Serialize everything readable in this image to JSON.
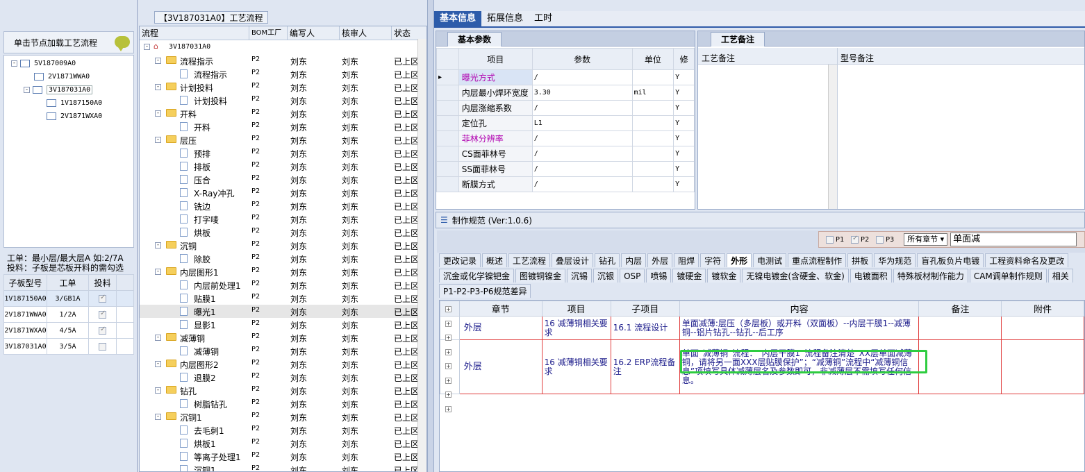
{
  "left": {
    "load_label": "单击节点加载工艺流程",
    "tree": [
      {
        "label": "5V187009A0",
        "level": 0,
        "expand": "-"
      },
      {
        "label": "2V1871WWA0",
        "level": 1,
        "expand": ""
      },
      {
        "label": "3V187031A0",
        "level": 1,
        "expand": "-",
        "selected": true
      },
      {
        "label": "1V187150A0",
        "level": 2,
        "expand": ""
      },
      {
        "label": "2V1871WXA0",
        "level": 2,
        "expand": ""
      }
    ],
    "info_line1": "工单：最小层/最大层A 如:2/7A",
    "info_line2": "投料：子板是芯板开料的需勾选",
    "sub_headers": [
      "子板型号",
      "工单",
      "投料"
    ],
    "sub_rows": [
      {
        "model": "1V187150A0",
        "order": "3/GB1A",
        "feed": true
      },
      {
        "model": "2V1871WWA0",
        "order": "1/2A",
        "feed": true
      },
      {
        "model": "2V1871WXA0",
        "order": "4/5A",
        "feed": true
      },
      {
        "model": "3V187031A0",
        "order": "3/5A",
        "feed": false
      }
    ]
  },
  "middle": {
    "title": "【3V187031A0】工艺流程",
    "headers": [
      "流程",
      "BOM工厂",
      "编写人",
      "核审人",
      "状态"
    ],
    "root": "3V187031A0",
    "rows": [
      {
        "label": "流程指示",
        "type": "folder"
      },
      {
        "label": "流程指示",
        "type": "doc"
      },
      {
        "label": "计划投料",
        "type": "folder"
      },
      {
        "label": "计划投料",
        "type": "doc"
      },
      {
        "label": "开料",
        "type": "folder"
      },
      {
        "label": "开料",
        "type": "doc"
      },
      {
        "label": "层压",
        "type": "folder"
      },
      {
        "label": "预排",
        "type": "doc"
      },
      {
        "label": "排板",
        "type": "doc"
      },
      {
        "label": "压合",
        "type": "doc"
      },
      {
        "label": "X-Ray冲孔",
        "type": "doc"
      },
      {
        "label": "铣边",
        "type": "doc"
      },
      {
        "label": "打字唛",
        "type": "doc"
      },
      {
        "label": "烘板",
        "type": "doc"
      },
      {
        "label": "沉铜",
        "type": "folder"
      },
      {
        "label": "除胶",
        "type": "doc"
      },
      {
        "label": "内层图形1",
        "type": "folder"
      },
      {
        "label": "内层前处理1",
        "type": "doc"
      },
      {
        "label": "贴膜1",
        "type": "doc"
      },
      {
        "label": "曝光1",
        "type": "doc",
        "selected": true
      },
      {
        "label": "显影1",
        "type": "doc"
      },
      {
        "label": "减薄铜",
        "type": "folder"
      },
      {
        "label": "减薄铜",
        "type": "doc"
      },
      {
        "label": "内层图形2",
        "type": "folder"
      },
      {
        "label": "退膜2",
        "type": "doc"
      },
      {
        "label": "钻孔",
        "type": "folder"
      },
      {
        "label": "树脂钻孔",
        "type": "doc"
      },
      {
        "label": "沉铜1",
        "type": "folder"
      },
      {
        "label": "去毛刺1",
        "type": "doc"
      },
      {
        "label": "烘板1",
        "type": "doc"
      },
      {
        "label": "等离子处理1",
        "type": "doc"
      },
      {
        "label": "沉铜1",
        "type": "doc"
      }
    ],
    "bom": "P2",
    "writer": "刘东",
    "reviewer": "刘东",
    "status": "已上区"
  },
  "top_tabs": [
    "基本信息",
    "拓展信息",
    "工时"
  ],
  "basic": {
    "tab": "基本参数",
    "headers": [
      "项目",
      "参数",
      "单位",
      "修"
    ],
    "rows": [
      {
        "item": "曝光方式",
        "param": "/",
        "unit": "",
        "mod": "Y",
        "mag": true,
        "current": true
      },
      {
        "item": "内层最小焊环宽度",
        "param": "3.30",
        "unit": "mil",
        "mod": "Y"
      },
      {
        "item": "内层涨缩系数",
        "param": "/",
        "unit": "",
        "mod": "Y"
      },
      {
        "item": "定位孔",
        "param": "L1",
        "unit": "",
        "mod": "Y"
      },
      {
        "item": "菲林分辨率",
        "param": "/",
        "unit": "",
        "mod": "Y",
        "mag": true
      },
      {
        "item": "CS面菲林号",
        "param": "/",
        "unit": "",
        "mod": "Y"
      },
      {
        "item": "SS面菲林号",
        "param": "/",
        "unit": "",
        "mod": "Y"
      },
      {
        "item": "断膜方式",
        "param": "/",
        "unit": "",
        "mod": "Y"
      }
    ]
  },
  "notes": {
    "tab": "工艺备注",
    "col1": "工艺备注",
    "col2": "型号备注"
  },
  "spec": {
    "title": "制作规范 (Ver:1.0.6)",
    "filters": [
      {
        "label": "P1",
        "checked": false
      },
      {
        "label": "P2",
        "checked": true
      },
      {
        "label": "P3",
        "checked": false
      }
    ],
    "chapter": "所有章节",
    "keyword": "单面减",
    "tabs_row1": [
      "更改记录",
      "概述",
      "工艺流程",
      "叠层设计",
      "钻孔",
      "内层",
      "外层",
      "阻焊",
      "字符",
      "外形",
      "电测试",
      "重点流程制作",
      "拼板",
      "华为规范",
      "盲孔板负片电镀",
      "工程资料命名及更改"
    ],
    "active_tab": "外形",
    "tabs_row2": [
      "沉金或化学镍钯金",
      "图镀铜镍金",
      "沉锡",
      "沉银",
      "OSP",
      "喷锡",
      "镀硬金",
      "镀软金",
      "无镍电镀金(含硬金、软金)",
      "电镀面积",
      "特殊板材制作能力",
      "CAM调单制作规则",
      "相关"
    ],
    "tabs_row3": [
      "P1-P2-P3-P6规范差异"
    ],
    "headers": [
      "章节",
      "项目",
      "子项目",
      "内容",
      "备注",
      "附件"
    ],
    "rows": [
      {
        "chapter": "外层",
        "item": "16 减薄铜相关要求",
        "sub": "16.1 流程设计",
        "content": "单面减薄:层压（多层板）或开料（双面板）--内层干膜1--减薄铜--铝片钻孔--钻孔--后工序",
        "note": "",
        "attach": ""
      },
      {
        "chapter": "外层",
        "item": "16 减薄铜相关要求",
        "sub": "16.2 ERP流程备注",
        "content": "单面“减薄铜”流程：“内层干膜1”流程备注清楚“XX层单面减薄铜，请将另一面XXX层贴膜保护”；“减薄铜”流程中“减薄铜信息”项填写具体减薄层名及参数即可，非减薄层不需填写任何信息。",
        "note": "",
        "attach": ""
      }
    ]
  }
}
